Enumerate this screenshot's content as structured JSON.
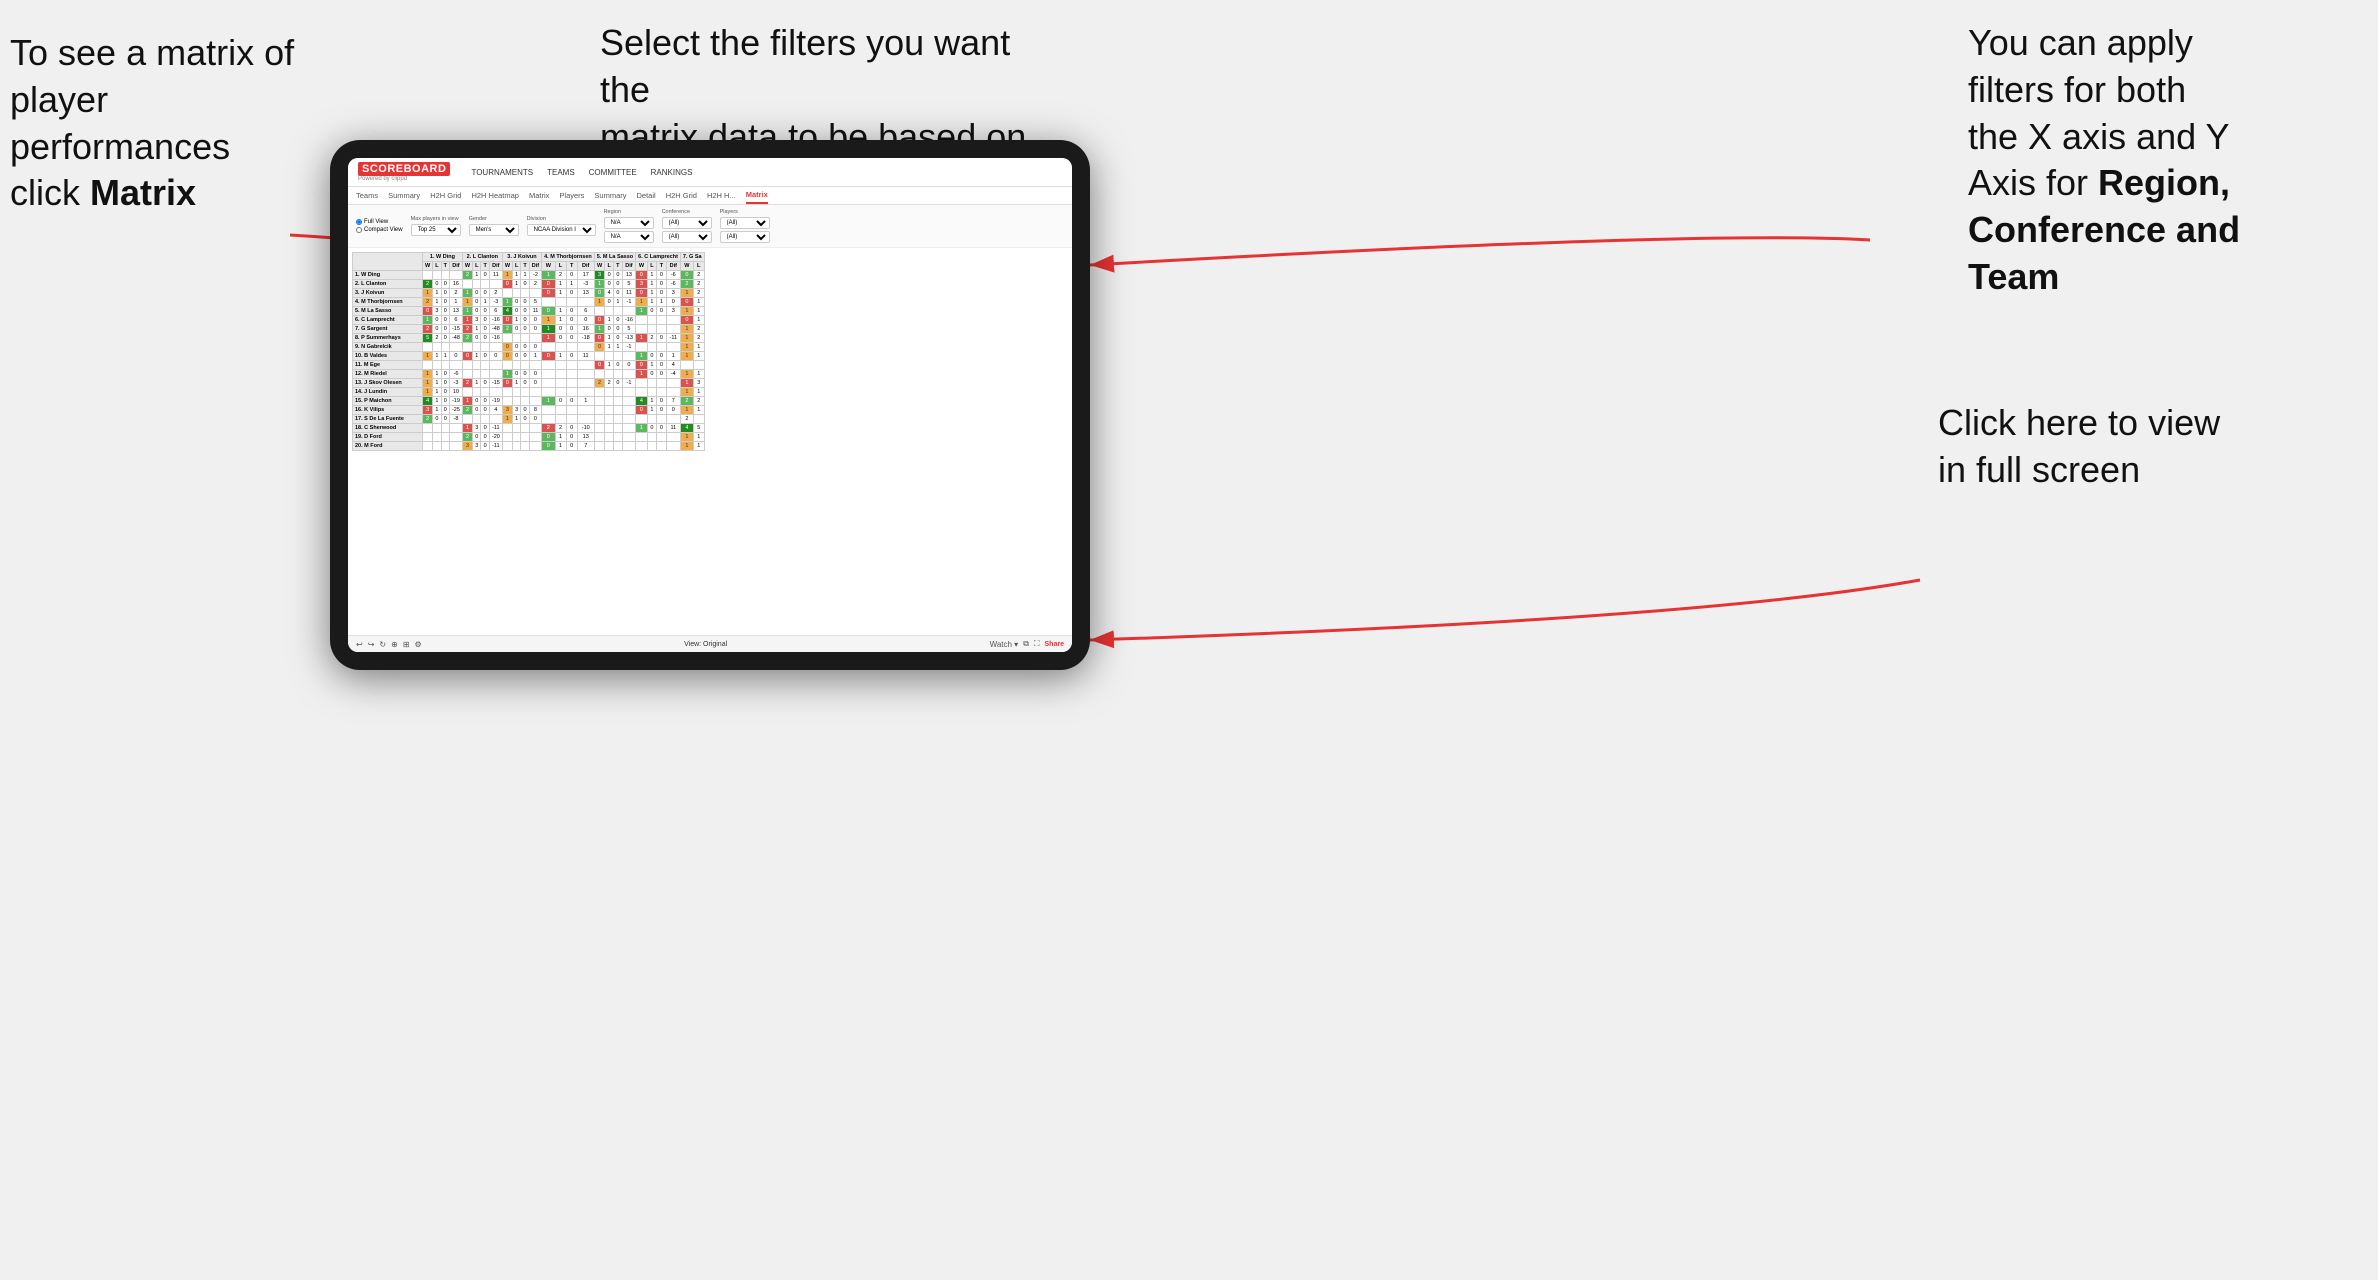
{
  "annotations": {
    "left": {
      "line1": "To see a matrix of",
      "line2": "player performances",
      "line3_plain": "click ",
      "line3_bold": "Matrix"
    },
    "center": {
      "line1": "Select the filters you want the",
      "line2": "matrix data to be based on"
    },
    "right": {
      "line1": "You  can apply",
      "line2": "filters for both",
      "line3": "the X axis and Y",
      "line4_plain": "Axis for ",
      "line4_bold": "Region,",
      "line5_bold": "Conference and",
      "line6_bold": "Team"
    },
    "bottom_right": {
      "line1": "Click here to view",
      "line2": "in full screen"
    }
  },
  "nav": {
    "logo": "SCOREBOARD",
    "powered_by": "Powered by clippd",
    "items": [
      "TOURNAMENTS",
      "TEAMS",
      "COMMITTEE",
      "RANKINGS"
    ]
  },
  "sub_tabs": {
    "teams_tab": "Teams",
    "summary_tab": "Summary",
    "h2h_grid_tab": "H2H Grid",
    "h2h_heatmap_tab": "H2H Heatmap",
    "matrix_tab": "Matrix",
    "players_tab": "Players",
    "summary2_tab": "Summary",
    "detail_tab": "Detail",
    "h2h_grid2_tab": "H2H Grid",
    "h2h_h_tab": "H2H H...",
    "active_tab": "Matrix"
  },
  "filters": {
    "view_options": [
      "Full View",
      "Compact View"
    ],
    "max_players_label": "Max players in view",
    "max_players_value": "Top 25",
    "gender_label": "Gender",
    "gender_value": "Men's",
    "division_label": "Division",
    "division_value": "NCAA Division I",
    "region_label": "Region",
    "region_value1": "N/A",
    "region_value2": "N/A",
    "conference_label": "Conference",
    "conference_value1": "(All)",
    "conference_value2": "(All)",
    "players_label": "Players",
    "players_value1": "(All)",
    "players_value2": "(All)"
  },
  "column_headers": [
    "1. W Ding",
    "2. L Clanton",
    "3. J Koivun",
    "4. M Thorbjornsen",
    "5. M La Sasso",
    "6. C Lamprecht",
    "7. G Sa"
  ],
  "sub_col_headers": [
    "W",
    "L",
    "T",
    "Dif"
  ],
  "row_players": [
    "1. W Ding",
    "2. L Clanton",
    "3. J Koivun",
    "4. M Thorbjornsen",
    "5. M La Sasso",
    "6. C Lamprecht",
    "7. G Sargent",
    "8. P Summerhays",
    "9. N Gabrelcik",
    "10. B Valdes",
    "11. M Ege",
    "12. M Riedel",
    "13. J Skov Olesen",
    "14. J Lundin",
    "15. P Maichon",
    "16. K Vilips",
    "17. S De La Fuente",
    "18. C Sherwood",
    "19. D Ford",
    "20. M Ford"
  ],
  "toolbar": {
    "view_label": "View: Original",
    "watch_label": "Watch ▾",
    "share_label": "Share"
  },
  "colors": {
    "red_arrow": "#e63333",
    "accent": "#e63333"
  }
}
